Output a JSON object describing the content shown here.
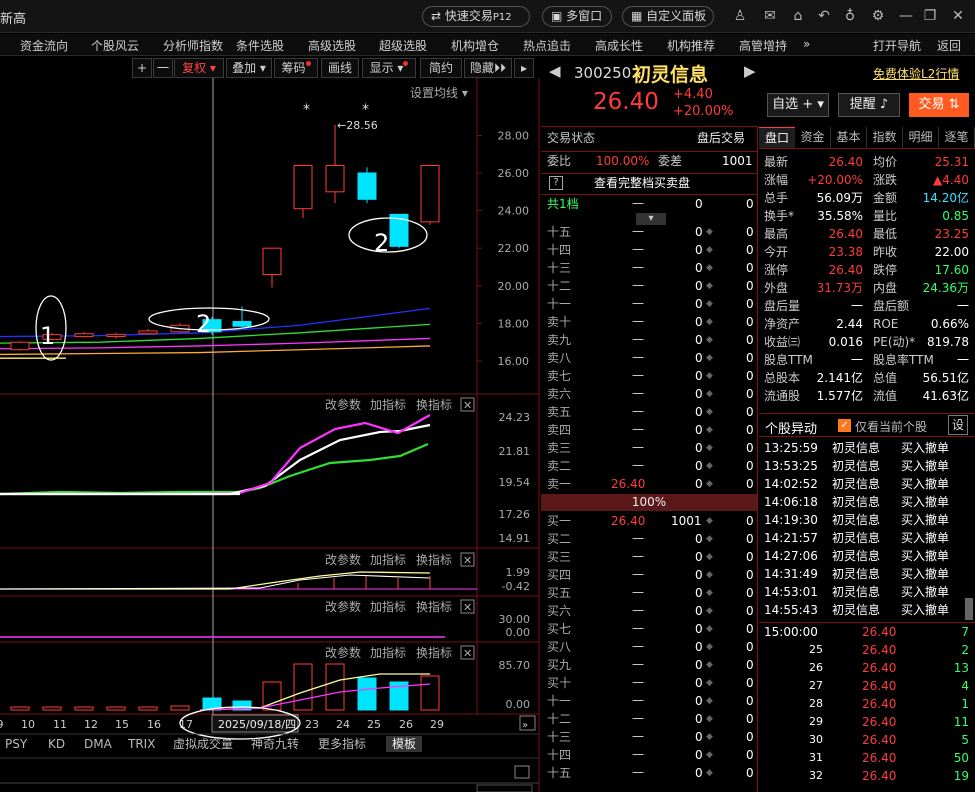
{
  "titlebar": {
    "title": "新高",
    "quick_trade": "快速交易",
    "quick_trade_key": "P12",
    "multi_window": "多窗口",
    "custom_panel": "自定义面板"
  },
  "menu": [
    "资金流向",
    "个股风云",
    "分析师指数",
    "条件选股",
    "高级选股",
    "超级选股",
    "机构增仓",
    "热点追击",
    "高成长性",
    "机构推荐",
    "高管增持"
  ],
  "menu_more": "»",
  "menu_right": [
    "打开导航",
    "返回"
  ],
  "chart_toolbar": {
    "plus": "+",
    "minus": "一",
    "fuquan": "复权",
    "diejia": "叠加",
    "chouma": "筹码",
    "huaxian": "画线",
    "xianshi": "显示",
    "jianyue": "简约",
    "yincang": "隐藏"
  },
  "ma_setting": "设置均线",
  "annotations": {
    "circle1": "1",
    "circle2a": "2",
    "circle2b": "2",
    "max_label": "←28.56"
  },
  "price_axis": [
    "28.00",
    "26.00",
    "24.00",
    "22.00",
    "20.00",
    "18.00",
    "16.00"
  ],
  "indicator_buttons": {
    "params": "改参数",
    "add": "加指标",
    "swap": "换指标"
  },
  "ind1_axis": [
    "24.23",
    "21.81",
    "19.54",
    "17.26",
    "14.91"
  ],
  "ind2_axis": [
    "1.99",
    "-0.42"
  ],
  "ind3_axis": [
    "30.00",
    "0.00"
  ],
  "ind4_axis": [
    "85.70",
    "0.00"
  ],
  "date_axis": [
    "9",
    "10",
    "11",
    "12",
    "15",
    "16",
    "17",
    "23",
    "24",
    "25",
    "26",
    "29"
  ],
  "date_cursor": "2025/09/18/四",
  "bottom_tabs": [
    "PSY",
    "KD",
    "DMA",
    "TRIX",
    "虚拟成交量",
    "神奇九转",
    "更多指标",
    "模板"
  ],
  "stock": {
    "code": "300250",
    "name": "初灵信息",
    "l2": "免费体验L2行情",
    "price": "26.40",
    "change": "+4.40",
    "change_pct": "+20.00%",
    "btn_watch": "自选",
    "btn_remind": "提醒",
    "btn_trade": "交易"
  },
  "trade_status": {
    "label": "交易状态",
    "value": "盘后交易"
  },
  "weibi": {
    "l1": "委比",
    "v1": "100.00%",
    "l2": "委差",
    "v2": "1001"
  },
  "full_depth": {
    "q": "?",
    "label": "查看完整档买卖盘"
  },
  "total_levels": {
    "label": "共1档",
    "v1": "一",
    "v2": "0",
    "v3": "0"
  },
  "sell_levels": [
    {
      "l": "十五",
      "p": "一",
      "v": "0",
      "d": "0"
    },
    {
      "l": "十四",
      "p": "一",
      "v": "0",
      "d": "0"
    },
    {
      "l": "十三",
      "p": "一",
      "v": "0",
      "d": "0"
    },
    {
      "l": "十二",
      "p": "一",
      "v": "0",
      "d": "0"
    },
    {
      "l": "十一",
      "p": "一",
      "v": "0",
      "d": "0"
    },
    {
      "l": "卖十",
      "p": "一",
      "v": "0",
      "d": "0"
    },
    {
      "l": "卖九",
      "p": "一",
      "v": "0",
      "d": "0"
    },
    {
      "l": "卖八",
      "p": "一",
      "v": "0",
      "d": "0"
    },
    {
      "l": "卖七",
      "p": "一",
      "v": "0",
      "d": "0"
    },
    {
      "l": "卖六",
      "p": "一",
      "v": "0",
      "d": "0"
    },
    {
      "l": "卖五",
      "p": "一",
      "v": "0",
      "d": "0"
    },
    {
      "l": "卖四",
      "p": "一",
      "v": "0",
      "d": "0"
    },
    {
      "l": "卖三",
      "p": "一",
      "v": "0",
      "d": "0"
    },
    {
      "l": "卖二",
      "p": "一",
      "v": "0",
      "d": "0"
    },
    {
      "l": "卖一",
      "p": "26.40",
      "v": "0",
      "d": "0"
    }
  ],
  "ratio_bar": "100%",
  "buy_levels": [
    {
      "l": "买一",
      "p": "26.40",
      "v": "1001",
      "d": "0"
    },
    {
      "l": "买二",
      "p": "一",
      "v": "0",
      "d": "0"
    },
    {
      "l": "买三",
      "p": "一",
      "v": "0",
      "d": "0"
    },
    {
      "l": "买四",
      "p": "一",
      "v": "0",
      "d": "0"
    },
    {
      "l": "买五",
      "p": "一",
      "v": "0",
      "d": "0"
    },
    {
      "l": "买六",
      "p": "一",
      "v": "0",
      "d": "0"
    },
    {
      "l": "买七",
      "p": "一",
      "v": "0",
      "d": "0"
    },
    {
      "l": "买八",
      "p": "一",
      "v": "0",
      "d": "0"
    },
    {
      "l": "买九",
      "p": "一",
      "v": "0",
      "d": "0"
    },
    {
      "l": "买十",
      "p": "一",
      "v": "0",
      "d": "0"
    },
    {
      "l": "十一",
      "p": "一",
      "v": "0",
      "d": "0"
    },
    {
      "l": "十二",
      "p": "一",
      "v": "0",
      "d": "0"
    },
    {
      "l": "十三",
      "p": "一",
      "v": "0",
      "d": "0"
    },
    {
      "l": "十四",
      "p": "一",
      "v": "0",
      "d": "0"
    },
    {
      "l": "十五",
      "p": "一",
      "v": "0",
      "d": "0"
    }
  ],
  "quote_tabs": [
    "盘口",
    "资金",
    "基本",
    "指数",
    "明细",
    "逐笔"
  ],
  "quote_rows": [
    {
      "a": "最新",
      "av": "26.40",
      "ac": "red",
      "b": "均价",
      "bv": "25.31",
      "bc": "red"
    },
    {
      "a": "涨幅",
      "av": "+20.00%",
      "ac": "red",
      "b": "涨跌",
      "bv": "▲4.40",
      "bc": "red"
    },
    {
      "a": "总手",
      "av": "56.09万",
      "ac": "white",
      "b": "金额",
      "bv": "14.20亿",
      "bc": "cyan"
    },
    {
      "a": "换手*",
      "av": "35.58%",
      "ac": "white",
      "b": "量比",
      "bv": "0.85",
      "bc": "grn"
    },
    {
      "a": "最高",
      "av": "26.40",
      "ac": "red",
      "b": "最低",
      "bv": "23.25",
      "bc": "red"
    },
    {
      "a": "今开",
      "av": "23.38",
      "ac": "red",
      "b": "昨收",
      "bv": "22.00",
      "bc": "white"
    },
    {
      "a": "涨停",
      "av": "26.40",
      "ac": "red",
      "b": "跌停",
      "bv": "17.60",
      "bc": "grn"
    },
    {
      "a": "外盘",
      "av": "31.73万",
      "ac": "red",
      "b": "内盘",
      "bv": "24.36万",
      "bc": "grn"
    },
    {
      "a": "盘后量",
      "av": "一",
      "ac": "white",
      "b": "盘后额",
      "bv": "一",
      "bc": "white"
    },
    {
      "a": "净资产",
      "av": "2.44",
      "ac": "white",
      "b": "ROE",
      "bv": "0.66%",
      "bc": "white"
    },
    {
      "a": "收益㈢",
      "av": "0.016",
      "ac": "white",
      "b": "PE(动)*",
      "bv": "819.78",
      "bc": "white"
    },
    {
      "a": "股息TTM",
      "av": "一",
      "ac": "white",
      "b": "股息率TTM",
      "bv": "一",
      "bc": "white"
    },
    {
      "a": "总股本",
      "av": "2.141亿",
      "ac": "white",
      "b": "总值",
      "bv": "56.51亿",
      "bc": "white"
    },
    {
      "a": "流通股",
      "av": "1.577亿",
      "ac": "white",
      "b": "流值",
      "bv": "41.63亿",
      "bc": "white"
    }
  ],
  "anomaly": {
    "title": "个股异动",
    "only_current": "仅看当前个股",
    "settings": "设"
  },
  "anomaly_rows": [
    {
      "t": "13:25:59",
      "n": "初灵信息",
      "e": "买入撤单"
    },
    {
      "t": "13:53:25",
      "n": "初灵信息",
      "e": "买入撤单"
    },
    {
      "t": "14:02:52",
      "n": "初灵信息",
      "e": "买入撤单"
    },
    {
      "t": "14:06:18",
      "n": "初灵信息",
      "e": "买入撤单"
    },
    {
      "t": "14:19:30",
      "n": "初灵信息",
      "e": "买入撤单"
    },
    {
      "t": "14:21:57",
      "n": "初灵信息",
      "e": "买入撤单"
    },
    {
      "t": "14:27:06",
      "n": "初灵信息",
      "e": "买入撤单"
    },
    {
      "t": "14:31:49",
      "n": "初灵信息",
      "e": "买入撤单"
    },
    {
      "t": "14:53:01",
      "n": "初灵信息",
      "e": "买入撤单"
    },
    {
      "t": "14:55:43",
      "n": "初灵信息",
      "e": "买入撤单"
    }
  ],
  "ticks": [
    {
      "t": "15:00:00",
      "p": "26.40",
      "v": "7"
    },
    {
      "t": "25",
      "p": "26.40",
      "v": "2"
    },
    {
      "t": "26",
      "p": "26.40",
      "v": "13"
    },
    {
      "t": "27",
      "p": "26.40",
      "v": "4"
    },
    {
      "t": "28",
      "p": "26.40",
      "v": "1"
    },
    {
      "t": "29",
      "p": "26.40",
      "v": "11"
    },
    {
      "t": "30",
      "p": "26.40",
      "v": "5"
    },
    {
      "t": "31",
      "p": "26.40",
      "v": "50"
    },
    {
      "t": "32",
      "p": "26.40",
      "v": "19"
    }
  ],
  "colors": {
    "up": "#ff3b3b",
    "down": "#00e5ff",
    "accent_orange": "#ff5a1f",
    "ma_blue": "#2233ff",
    "ma_green": "#33dd33",
    "ma_magenta": "#ff33ff",
    "ma_orange": "#ffaa33"
  },
  "candles": [
    {
      "o": 16.6,
      "c": 17.0,
      "h": 17.05,
      "l": 16.55
    },
    {
      "o": 17.15,
      "c": 17.4,
      "h": 17.5,
      "l": 17.1
    },
    {
      "o": 17.3,
      "c": 17.45,
      "h": 17.55,
      "l": 17.25
    },
    {
      "o": 17.3,
      "c": 17.42,
      "h": 17.5,
      "l": 17.2
    },
    {
      "o": 17.45,
      "c": 17.6,
      "h": 17.7,
      "l": 17.4
    },
    {
      "o": 17.55,
      "c": 17.9,
      "h": 18.0,
      "l": 17.5
    },
    {
      "o": 18.2,
      "c": 17.55,
      "h": 18.35,
      "l": 17.4
    },
    {
      "o": 18.1,
      "c": 17.85,
      "h": 18.9,
      "l": 17.8
    },
    {
      "o": 20.6,
      "c": 22.0,
      "h": 22.0,
      "l": 19.9
    },
    {
      "o": 24.1,
      "c": 26.4,
      "h": 26.4,
      "l": 23.6
    },
    {
      "o": 25.0,
      "c": 26.4,
      "h": 28.56,
      "l": 24.4
    },
    {
      "o": 26.0,
      "c": 24.6,
      "h": 26.3,
      "l": 24.4
    },
    {
      "o": 23.8,
      "c": 22.1,
      "h": 23.8,
      "l": 22.0
    },
    {
      "o": 23.4,
      "c": 26.4,
      "h": 26.4,
      "l": 23.25
    }
  ]
}
